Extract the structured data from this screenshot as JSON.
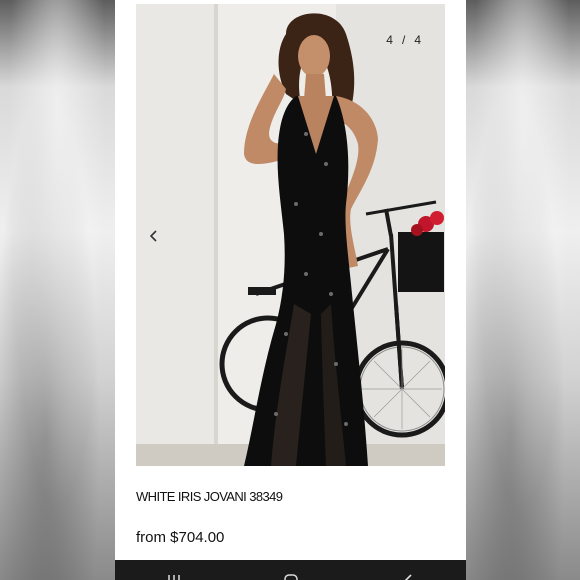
{
  "gallery": {
    "current": "4",
    "separator": "/",
    "total": "4",
    "prev_icon": "chevron-left-icon"
  },
  "product": {
    "title": "WHITE IRIS JOVANI 38349",
    "price": "from $704.00"
  },
  "nav": {
    "recents_icon": "recents-icon",
    "home_icon": "home-icon",
    "back_icon": "back-icon"
  },
  "colors": {
    "navbar": "#1b1b1b",
    "text": "#111111",
    "dress": "#0d0d0d"
  }
}
